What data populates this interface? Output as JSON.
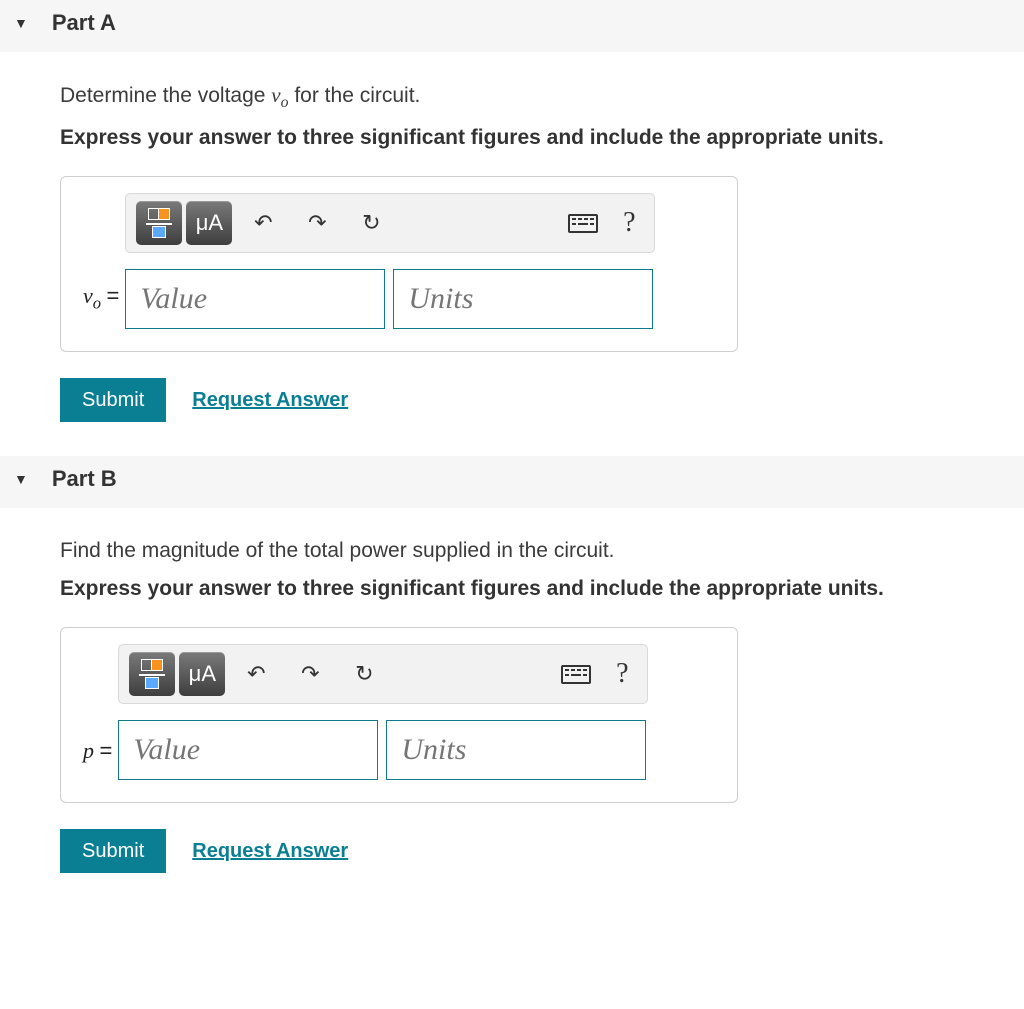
{
  "parts": [
    {
      "title": "Part A",
      "prompt_pre": "Determine the voltage ",
      "prompt_var": "v",
      "prompt_sub": "o",
      "prompt_post": " for the circuit.",
      "instruction": "Express your answer to three significant figures and include the appropriate units.",
      "lhs_var": "v",
      "lhs_sub": "o",
      "value_placeholder": "Value",
      "units_placeholder": "Units",
      "submit_label": "Submit",
      "request_label": "Request Answer",
      "toolbar_mu": "μA"
    },
    {
      "title": "Part B",
      "prompt_plain": "Find the magnitude of the total power supplied in the circuit.",
      "instruction": "Express your answer to three significant figures and include the appropriate units.",
      "lhs_var": "p",
      "value_placeholder": "Value",
      "units_placeholder": "Units",
      "submit_label": "Submit",
      "request_label": "Request Answer",
      "toolbar_mu": "μA"
    }
  ]
}
